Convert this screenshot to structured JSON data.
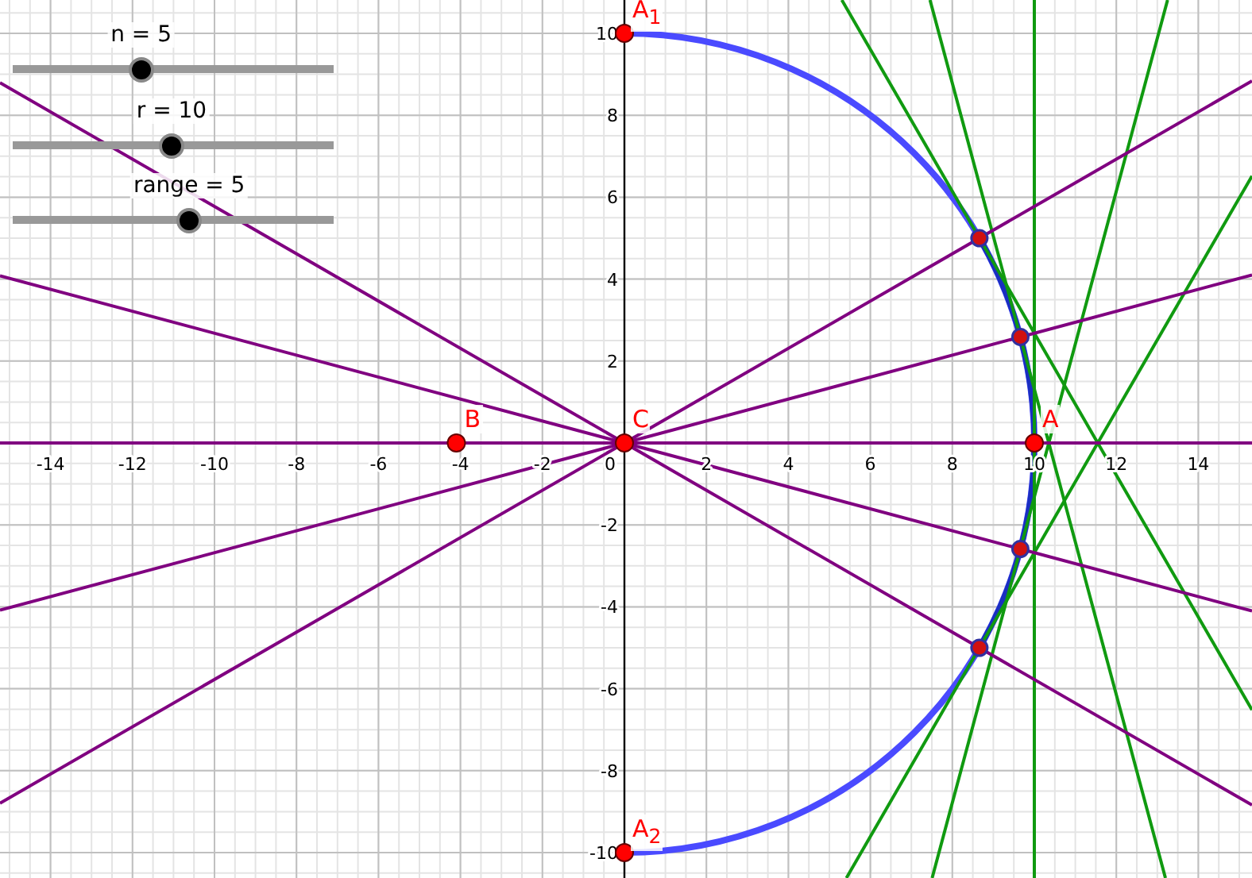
{
  "sliders": [
    {
      "label": "n = 5",
      "level": 0.4
    },
    {
      "label": "r = 10",
      "level": 0.495
    },
    {
      "label": "range = 5",
      "level": 0.55
    }
  ],
  "axes": {
    "x_labels": [
      "-14",
      "-12",
      "-10",
      "-8",
      "-6",
      "-4",
      "-2",
      "0",
      "2",
      "4",
      "6",
      "8",
      "10",
      "12",
      "14"
    ],
    "y_labels_positive": [
      "10",
      "8",
      "6",
      "4",
      "2"
    ],
    "y_labels_negative": [
      "-2",
      "-4",
      "-6",
      "-8",
      "-10"
    ]
  },
  "points": [
    {
      "label": "A$_{1}$"
    },
    {
      "label": "B"
    },
    {
      "label": "C"
    },
    {
      "label": "A"
    },
    {
      "label": "A$_{2}$"
    }
  ]
}
